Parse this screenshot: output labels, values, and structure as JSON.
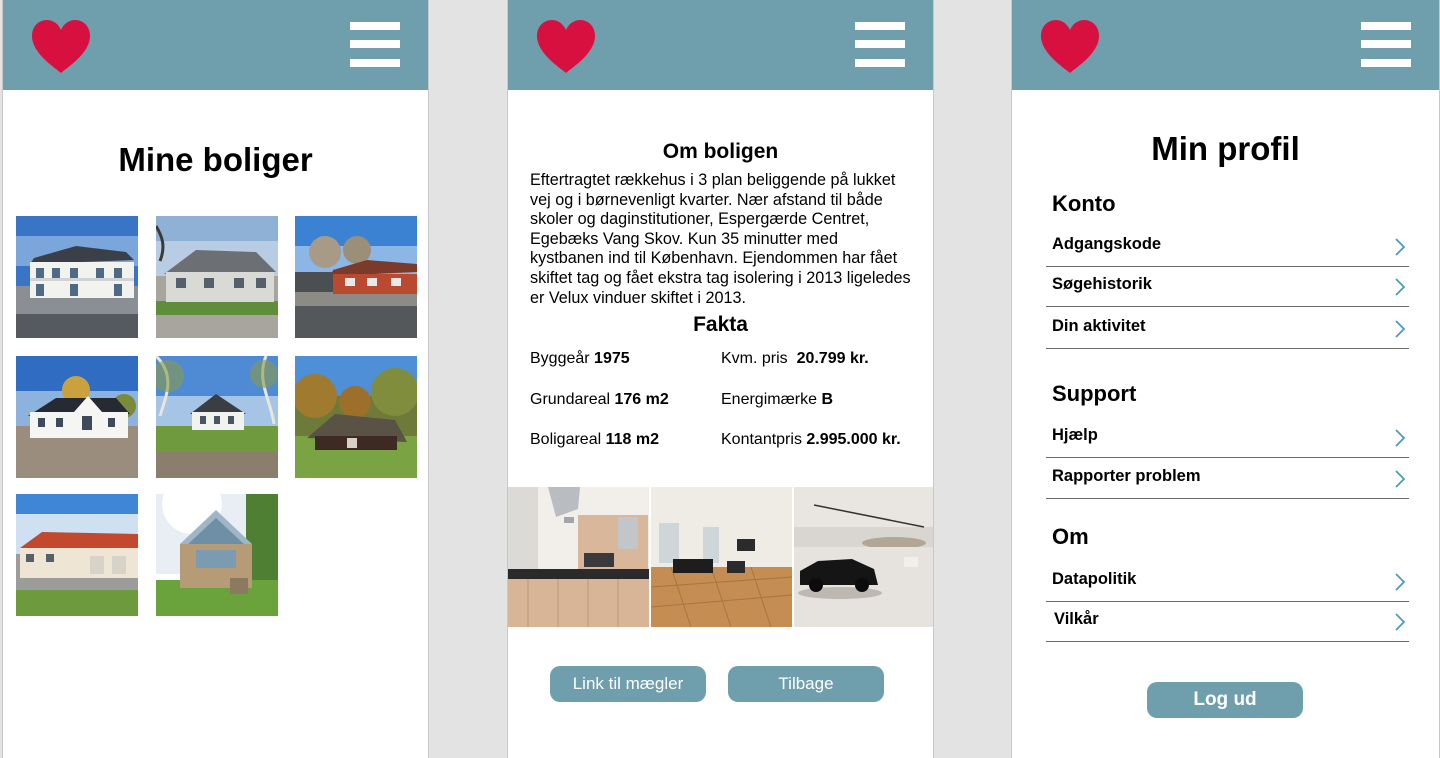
{
  "colors": {
    "accent": "#6f9fad",
    "heart": "#d8103f",
    "background": "#e3e3e3"
  },
  "icons": {
    "logo": "heart-icon",
    "menu": "hamburger-menu-icon",
    "chevron": "chevron-right-icon"
  },
  "screen1": {
    "title": "Mine boliger",
    "houses": [
      "house-photo",
      "house-photo",
      "house-photo",
      "house-photo",
      "house-photo",
      "house-photo",
      "house-photo",
      "house-photo"
    ]
  },
  "screen2": {
    "about_heading": "Om boligen",
    "description": "Eftertragtet rækkehus i 3 plan beliggende på lukket vej og i børnevenligt kvarter. Nær afstand til både skoler og daginstitutioner, Espergærde Centret, Egebæks Vang Skov. Kun 35 minutter med kystbanen ind til København. Ejendommen har fået skiftet tag og fået ekstra tag isolering i 2013 ligeledes er Velux vinduer skiftet i 2013.",
    "facts_heading": "Fakta",
    "facts": [
      {
        "label": "Byggeår",
        "value": "1975"
      },
      {
        "label": "Kvm. pris",
        "value": "20.799 kr."
      },
      {
        "label": "Grundareal",
        "value": "176 m2"
      },
      {
        "label": "Energimærke",
        "value": "B"
      },
      {
        "label": "Boligareal",
        "value": "118 m2"
      },
      {
        "label": "Kontantpris",
        "value": "2.995.000 kr."
      }
    ],
    "photos": [
      "kitchen-photo",
      "living-room-photo",
      "garage-photo"
    ],
    "broker_button": "Link til mægler",
    "back_button": "Tilbage"
  },
  "screen3": {
    "title": "Min profil",
    "sections": [
      {
        "heading": "Konto",
        "items": [
          "Adgangskode",
          "Søgehistorik",
          "Din aktivitet"
        ]
      },
      {
        "heading": "Support",
        "items": [
          "Hjælp",
          "Rapporter problem"
        ]
      },
      {
        "heading": "Om",
        "items": [
          "Datapolitik",
          "Vilkår"
        ]
      }
    ],
    "logout_button": "Log ud"
  }
}
